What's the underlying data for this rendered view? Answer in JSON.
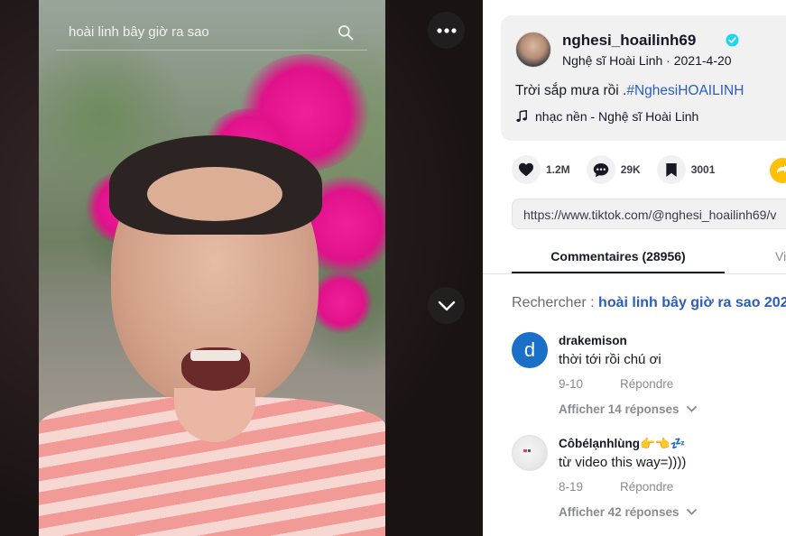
{
  "video": {
    "search_text": "hoài linh bây giờ ra sao"
  },
  "author": {
    "username": "nghesi_hoailinh69",
    "display_line": "Nghệ sĩ Hoài Linh · 2021-4-20",
    "caption_text": "Trời sắp mưa rồi .",
    "caption_hashtag": "#NghesiHOAILINH",
    "music": "nhạc nền - Nghệ sĩ Hoài Linh"
  },
  "actions": {
    "likes": "1.2M",
    "comments": "29K",
    "saves": "3001"
  },
  "link": {
    "url": "https://www.tiktok.com/@nghesi_hoailinh69/v"
  },
  "tabs": {
    "comments_label": "Commentaires (28956)",
    "other_label": "Vi"
  },
  "search_suggest": {
    "label": "Rechercher : ",
    "query": "hoài linh bây giờ ra sao 202"
  },
  "comments": [
    {
      "avatar_letter": "d",
      "user": "drakemison",
      "text": "thời tới rồi chú ơi",
      "date": "9-10",
      "reply_label": "Répondre",
      "more_label": "Afficher 14 réponses"
    },
    {
      "avatar_letter": "",
      "user": "Côbélạnhlùng👉👈💤",
      "text": "từ video this way=))))",
      "date": "8-19",
      "reply_label": "Répondre",
      "more_label": "Afficher 42 réponses"
    }
  ],
  "colors": {
    "link_blue": "#2b5db9",
    "verified": "#20d5ec",
    "avatar_blue": "#1a6fc9",
    "share_yellow": "#fec106"
  }
}
